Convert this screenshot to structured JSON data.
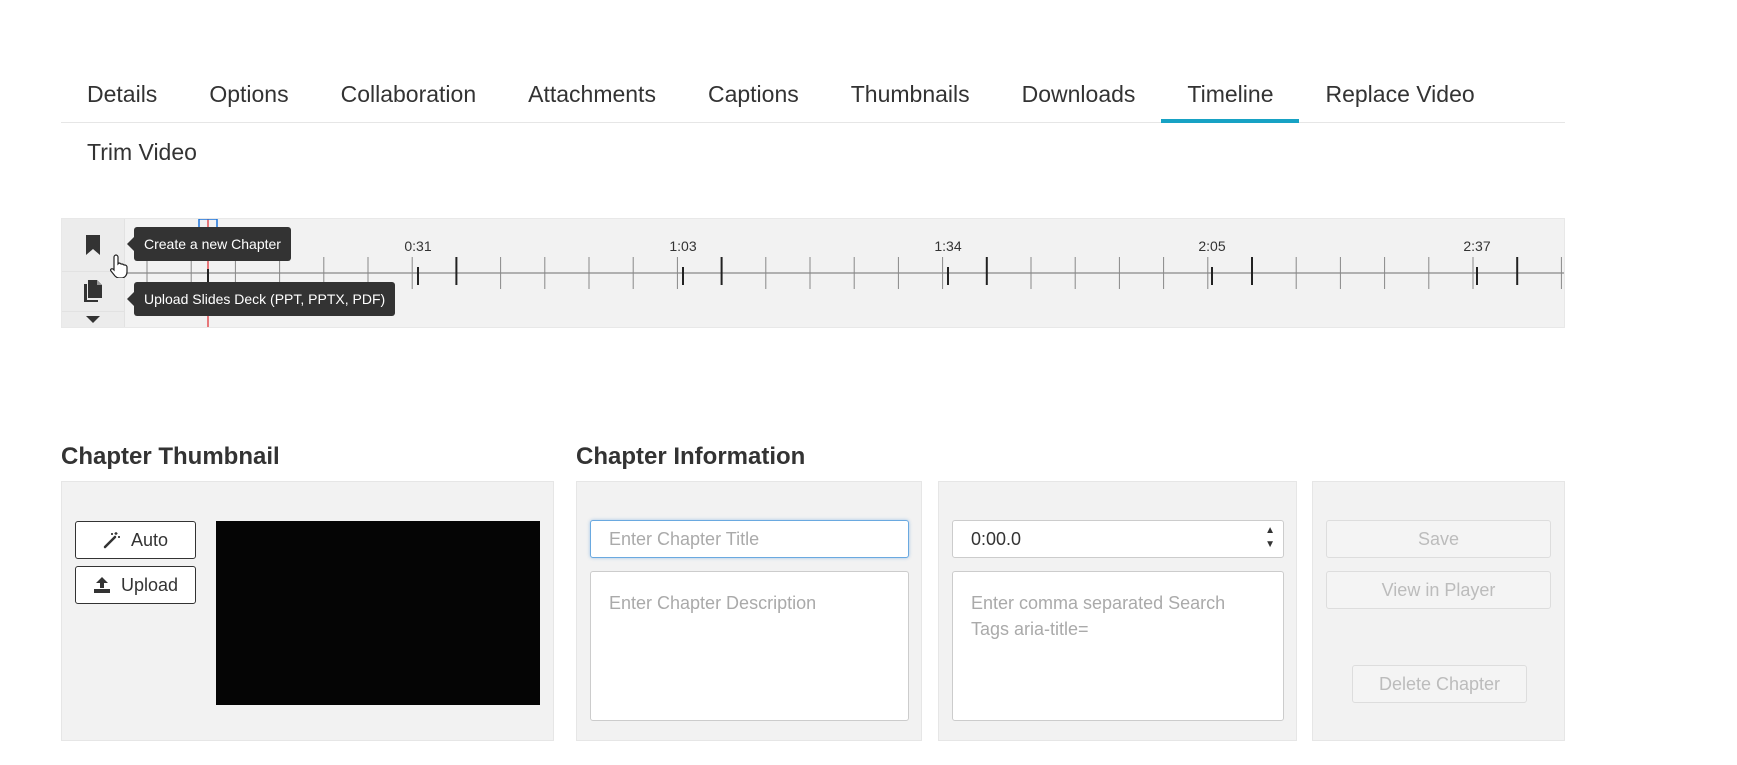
{
  "tabs": {
    "items": [
      "Details",
      "Options",
      "Collaboration",
      "Attachments",
      "Captions",
      "Thumbnails",
      "Downloads",
      "Timeline",
      "Replace Video"
    ],
    "second_row": [
      "Trim Video"
    ],
    "active": "Timeline"
  },
  "timeline": {
    "tick_labels": [
      "0:31",
      "1:03",
      "1:34",
      "2:05",
      "2:37"
    ],
    "tools": {
      "chapter_icon": "bookmark-icon",
      "slides_icon": "file-copy-icon",
      "more_icon": "caret-down-icon"
    },
    "tooltips": {
      "chapter": "Create a new Chapter",
      "slides": "Upload Slides Deck (PPT, PPTX, PDF)"
    },
    "accent_color": "#1a73d9",
    "playhead_color": "#e0252b"
  },
  "chapter_thumbnail": {
    "heading": "Chapter Thumbnail",
    "auto_label": "Auto",
    "upload_label": "Upload",
    "auto_icon": "magic-wand-icon",
    "upload_icon": "upload-icon"
  },
  "chapter_info": {
    "heading": "Chapter Information",
    "title_placeholder": "Enter Chapter Title",
    "title_value": "",
    "description_placeholder": "Enter Chapter Description",
    "time_value": "0:00.0",
    "tags_placeholder": "Enter comma separated Search Tags aria-title=",
    "save_label": "Save",
    "view_label": "View in Player",
    "delete_label": "Delete Chapter"
  },
  "colors": {
    "accent": "#17a2c4"
  }
}
